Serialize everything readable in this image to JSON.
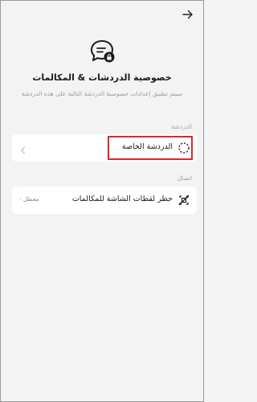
{
  "header": {
    "back_icon": "arrow-right-icon"
  },
  "hero": {
    "icon": "chat-bubble-lock-icon",
    "title": "خصوصية الدردشات & المكالمات",
    "subtitle": "سيتم تطبيق إعدادات خصوصية الدردشة التالية على هذه الدردشة"
  },
  "sections": {
    "chat": {
      "label": "الدردشة",
      "row": {
        "label": "الدردشة الخاصة",
        "icon": "dashed-circle-icon",
        "chevron_icon": "chevron-left-icon"
      }
    },
    "call": {
      "label": "اتصال",
      "row": {
        "label": "حظر لقطات الشاشة للمكالمات",
        "icon": "screenshot-blocked-icon",
        "status": "معطل",
        "chevron_icon": "chevron-left-icon"
      }
    }
  },
  "colors": {
    "background": "#f3f3f3",
    "card": "#ffffff",
    "highlight": "#e0262a"
  }
}
